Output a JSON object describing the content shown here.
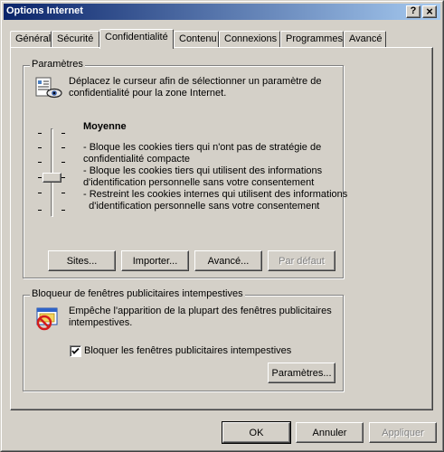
{
  "window": {
    "title": "Options Internet",
    "help_button": "?",
    "close_button": "×"
  },
  "tabs": [
    {
      "label": "Général",
      "active": false
    },
    {
      "label": "Sécurité",
      "active": false
    },
    {
      "label": "Confidentialité",
      "active": true
    },
    {
      "label": "Contenu",
      "active": false
    },
    {
      "label": "Connexions",
      "active": false
    },
    {
      "label": "Programmes",
      "active": false
    },
    {
      "label": "Avancé",
      "active": false
    }
  ],
  "settings": {
    "legend": "Paramètres",
    "description_line1": "Déplacez le curseur afin de sélectionner un paramètre de",
    "description_line2": "confidentialité pour la zone Internet.",
    "level_name": "Moyenne",
    "level_lines": [
      "- Bloque les cookies tiers qui n'ont pas de stratégie de",
      "confidentialité compacte",
      "- Bloque les cookies tiers qui utilisent des informations",
      "d'identification personnelle sans votre consentement",
      "- Restreint les cookies internes qui utilisent des informations",
      "  d'identification personnelle sans votre consentement"
    ],
    "slider_level_index": 3,
    "slider_levels_total": 6,
    "buttons": {
      "sites": "Sites...",
      "import": "Importer...",
      "advanced": "Avancé...",
      "default": "Par défaut"
    }
  },
  "popup_blocker": {
    "legend": "Bloqueur de fenêtres publicitaires intempestives",
    "description_line1": "Empêche l'apparition de la plupart des fenêtres publicitaires",
    "description_line2": "intempestives.",
    "checkbox_label": "Bloquer les fenêtres publicitaires intempestives",
    "checkbox_checked": true,
    "settings_button": "Paramètres..."
  },
  "footer": {
    "ok": "OK",
    "cancel": "Annuler",
    "apply": "Appliquer"
  }
}
